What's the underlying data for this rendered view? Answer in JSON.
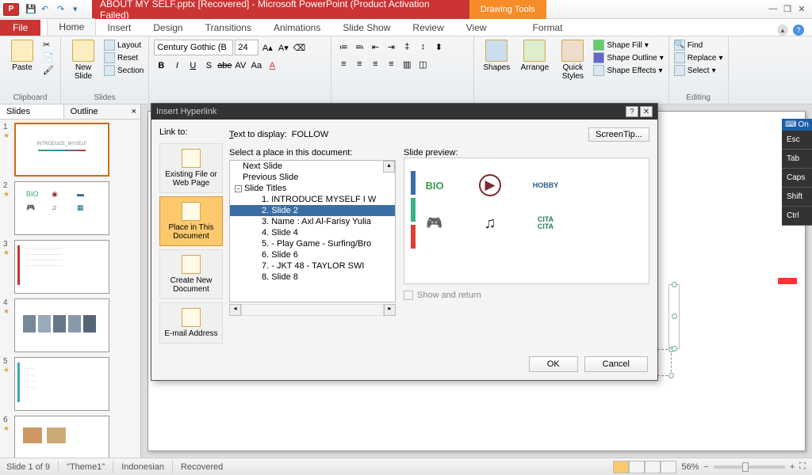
{
  "title": "ABOUT MY SELF.pptx [Recovered]  -  Microsoft PowerPoint (Product Activation Failed)",
  "context_tab_group": "Drawing Tools",
  "tabs": {
    "file": "File",
    "home": "Home",
    "insert": "Insert",
    "design": "Design",
    "transitions": "Transitions",
    "animations": "Animations",
    "slideshow": "Slide Show",
    "review": "Review",
    "view": "View",
    "format": "Format"
  },
  "ribbon": {
    "clipboard": {
      "paste": "Paste",
      "label": "Clipboard"
    },
    "slides": {
      "new": "New\nSlide",
      "layout": "Layout",
      "reset": "Reset",
      "section": "Section",
      "label": "Slides"
    },
    "font": {
      "name": "Century Gothic (B",
      "size": "24",
      "buttons": [
        "B",
        "I",
        "U",
        "S",
        "abe",
        "AV",
        "Aa",
        "A"
      ]
    },
    "drawing": {
      "shapes": "Shapes",
      "arrange": "Arrange",
      "quick": "Quick\nStyles",
      "fill": "Shape Fill",
      "outline": "Shape Outline",
      "effects": "Shape Effects"
    },
    "editing": {
      "find": "Find",
      "replace": "Replace",
      "select": "Select",
      "label": "Editing"
    }
  },
  "panel": {
    "slides": "Slides",
    "outline": "Outline"
  },
  "thumbnails": [
    "1",
    "2",
    "3",
    "4",
    "5",
    "6"
  ],
  "thumb1_title": "INTRODUCE_MYSELF",
  "dialog": {
    "title": "Insert Hyperlink",
    "linkto_label": "Link to:",
    "text_to_display_label": "Text to display:",
    "text_to_display_value": "FOLLOW",
    "screentip": "ScreenTip...",
    "opts": {
      "existing": "Existing File or Web Page",
      "place": "Place in This Document",
      "create": "Create New Document",
      "email": "E-mail Address"
    },
    "select_label": "Select a place in this document:",
    "preview_label": "Slide preview:",
    "tree": {
      "next": "Next Slide",
      "prev": "Previous Slide",
      "titles": "Slide Titles",
      "items": [
        "1. INTRODUCE MYSELF I W",
        "2. Slide 2",
        "3. Name  : Axl Al-Farisy Yulia",
        "4. Slide 4",
        "5. - Play Game  - Surfing/Bro",
        "6. Slide 6",
        "7. - JKT 48  - TAYLOR  SWI",
        "8. Slide 8"
      ]
    },
    "show_return": "Show and return",
    "ok": "OK",
    "cancel": "Cancel"
  },
  "preview_icons": [
    "BIO",
    "▶",
    "HOBBY",
    "🎮",
    "♫",
    "CITA"
  ],
  "osk": {
    "hdr": "On",
    "keys": [
      "Esc",
      "Tab",
      "Caps",
      "Shift",
      "Ctrl"
    ]
  },
  "status": {
    "slide": "Slide 1 of 9",
    "theme": "\"Theme1\"",
    "lang": "Indonesian",
    "recovered": "Recovered",
    "zoom": "56%"
  }
}
